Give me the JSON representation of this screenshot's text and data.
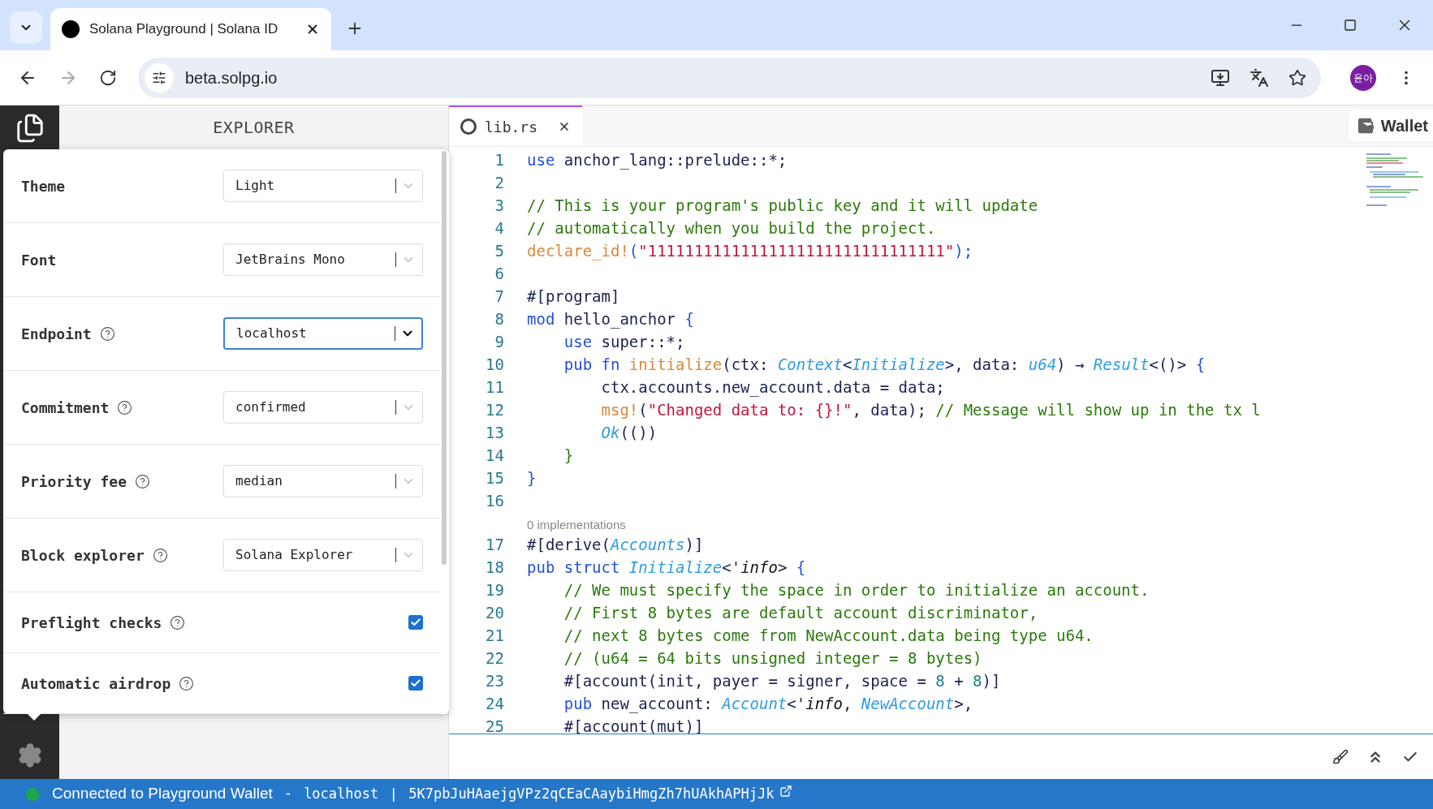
{
  "browser": {
    "tab_title": "Solana Playground | Solana ID",
    "url": "beta.solpg.io",
    "profile": "윤아"
  },
  "explorer": {
    "title": "EXPLORER"
  },
  "settings": [
    {
      "kind": "select",
      "label": "Theme",
      "help": false,
      "value": "Light",
      "focused": false
    },
    {
      "kind": "select",
      "label": "Font",
      "help": false,
      "value": "JetBrains Mono",
      "focused": false
    },
    {
      "kind": "select",
      "label": "Endpoint",
      "help": true,
      "value": "localhost",
      "focused": true
    },
    {
      "kind": "select",
      "label": "Commitment",
      "help": true,
      "value": "confirmed",
      "focused": false
    },
    {
      "kind": "select",
      "label": "Priority fee",
      "help": true,
      "value": "median",
      "focused": false
    },
    {
      "kind": "select",
      "label": "Block explorer",
      "help": true,
      "value": "Solana Explorer",
      "focused": false
    },
    {
      "kind": "checkbox",
      "label": "Preflight checks",
      "help": true,
      "checked": true
    },
    {
      "kind": "checkbox",
      "label": "Automatic airdrop",
      "help": true,
      "checked": true
    }
  ],
  "editor": {
    "tab": "lib.rs",
    "wallet_button": "Wallet",
    "lines": [
      {
        "kind": "code",
        "number": "1",
        "tokens": [
          {
            "text": "use",
            "kind": "kw"
          },
          {
            "text": " anchor_lang::prelude::*;",
            "kind": "plain"
          }
        ]
      },
      {
        "kind": "code",
        "number": "2"
      },
      {
        "kind": "code",
        "number": "3",
        "tokens": [
          {
            "text": "// This is your program's public key and it will update",
            "kind": "comment"
          }
        ]
      },
      {
        "kind": "code",
        "number": "4",
        "tokens": [
          {
            "text": "// automatically when you build the project.",
            "kind": "comment"
          }
        ]
      },
      {
        "kind": "code",
        "number": "5",
        "tokens": [
          {
            "text": "declare_id!",
            "kind": "fn"
          },
          {
            "text": "(",
            "kind": "punct"
          },
          {
            "text": "\"11111111111111111111111111111111\"",
            "kind": "string"
          },
          {
            "text": ");",
            "kind": "punct"
          }
        ]
      },
      {
        "kind": "code",
        "number": "6"
      },
      {
        "kind": "code",
        "number": "7",
        "tokens": [
          {
            "text": "#[program]",
            "kind": "plain"
          }
        ]
      },
      {
        "kind": "code",
        "number": "8",
        "tokens": [
          {
            "text": "mod",
            "kind": "kw"
          },
          {
            "text": " hello_anchor ",
            "kind": "plain"
          },
          {
            "text": "{",
            "kind": "punct"
          }
        ]
      },
      {
        "kind": "code",
        "number": "9",
        "tokens": [
          {
            "text": "    use",
            "kind": "kw"
          },
          {
            "text": " super::*;",
            "kind": "plain"
          }
        ]
      },
      {
        "kind": "code",
        "number": "10",
        "tokens": [
          {
            "text": "    pub fn ",
            "kind": "kw"
          },
          {
            "text": "initialize",
            "kind": "fn"
          },
          {
            "text": "(ctx: ",
            "kind": "plain"
          },
          {
            "text": "Context",
            "kind": "type"
          },
          {
            "text": "<",
            "kind": "plain"
          },
          {
            "text": "Initialize",
            "kind": "type"
          },
          {
            "text": ">, data: ",
            "kind": "plain"
          },
          {
            "text": "u64",
            "kind": "type"
          },
          {
            "text": ") → ",
            "kind": "plain"
          },
          {
            "text": "Result",
            "kind": "type"
          },
          {
            "text": "<()> ",
            "kind": "plain"
          },
          {
            "text": "{",
            "kind": "punct"
          }
        ]
      },
      {
        "kind": "code",
        "number": "11",
        "tokens": [
          {
            "text": "        ctx.accounts.new_account.data = data;",
            "kind": "plain"
          }
        ]
      },
      {
        "kind": "code",
        "number": "12",
        "tokens": [
          {
            "text": "        msg!",
            "kind": "fn"
          },
          {
            "text": "(",
            "kind": "plain"
          },
          {
            "text": "\"Changed data to: {}!\"",
            "kind": "string"
          },
          {
            "text": ", data); ",
            "kind": "plain"
          },
          {
            "text": "// Message will show up in the tx l",
            "kind": "comment"
          }
        ]
      },
      {
        "kind": "code",
        "number": "13",
        "tokens": [
          {
            "text": "        Ok",
            "kind": "type"
          },
          {
            "text": "(())",
            "kind": "plain"
          }
        ]
      },
      {
        "kind": "code",
        "number": "14",
        "tokens": [
          {
            "text": "    }",
            "kind": "brace"
          }
        ]
      },
      {
        "kind": "code",
        "number": "15",
        "tokens": [
          {
            "text": "}",
            "kind": "punct"
          }
        ]
      },
      {
        "kind": "code",
        "number": "16"
      },
      {
        "kind": "lens",
        "text": "0 implementations"
      },
      {
        "kind": "code",
        "number": "17",
        "tokens": [
          {
            "text": "#[derive(",
            "kind": "plain"
          },
          {
            "text": "Accounts",
            "kind": "type"
          },
          {
            "text": ")]",
            "kind": "plain"
          }
        ]
      },
      {
        "kind": "code",
        "number": "18",
        "tokens": [
          {
            "text": "pub struct ",
            "kind": "kw"
          },
          {
            "text": "Initialize",
            "kind": "type"
          },
          {
            "text": "<'",
            "kind": "plain"
          },
          {
            "text": "info",
            "kind": "lifetime"
          },
          {
            "text": "> ",
            "kind": "plain"
          },
          {
            "text": "{",
            "kind": "punct"
          }
        ]
      },
      {
        "kind": "code",
        "number": "19",
        "tokens": [
          {
            "text": "    // We must specify the space in order to initialize an account.",
            "kind": "comment"
          }
        ]
      },
      {
        "kind": "code",
        "number": "20",
        "tokens": [
          {
            "text": "    // First 8 bytes are default account discriminator,",
            "kind": "comment"
          }
        ]
      },
      {
        "kind": "code",
        "number": "21",
        "tokens": [
          {
            "text": "    // next 8 bytes come from NewAccount.data being type u64.",
            "kind": "comment"
          }
        ]
      },
      {
        "kind": "code",
        "number": "22",
        "tokens": [
          {
            "text": "    // (u64 = 64 bits unsigned integer = 8 bytes)",
            "kind": "comment"
          }
        ]
      },
      {
        "kind": "code",
        "number": "23",
        "tokens": [
          {
            "text": "    #[account(init, payer = signer, space = ",
            "kind": "plain"
          },
          {
            "text": "8",
            "kind": "number"
          },
          {
            "text": " + ",
            "kind": "plain"
          },
          {
            "text": "8",
            "kind": "number"
          },
          {
            "text": ")]",
            "kind": "plain"
          }
        ]
      },
      {
        "kind": "code",
        "number": "24",
        "tokens": [
          {
            "text": "    pub",
            "kind": "kw"
          },
          {
            "text": " new_account: ",
            "kind": "plain"
          },
          {
            "text": "Account",
            "kind": "type"
          },
          {
            "text": "<'",
            "kind": "plain"
          },
          {
            "text": "info",
            "kind": "lifetime"
          },
          {
            "text": ", ",
            "kind": "plain"
          },
          {
            "text": "NewAccount",
            "kind": "type"
          },
          {
            "text": ">,",
            "kind": "plain"
          }
        ]
      },
      {
        "kind": "code",
        "number": "25",
        "tokens": [
          {
            "text": "    #[account(mut)]",
            "kind": "plain"
          }
        ]
      }
    ]
  },
  "status_bar": {
    "connection": "Connected to Playground Wallet",
    "separator_1": "-",
    "endpoint": "localhost",
    "separator_2": "|",
    "address": "5K7pbJuHAaejgVPz2qCEaCAaybiHmgZh7hUAkhAPHjJk"
  }
}
